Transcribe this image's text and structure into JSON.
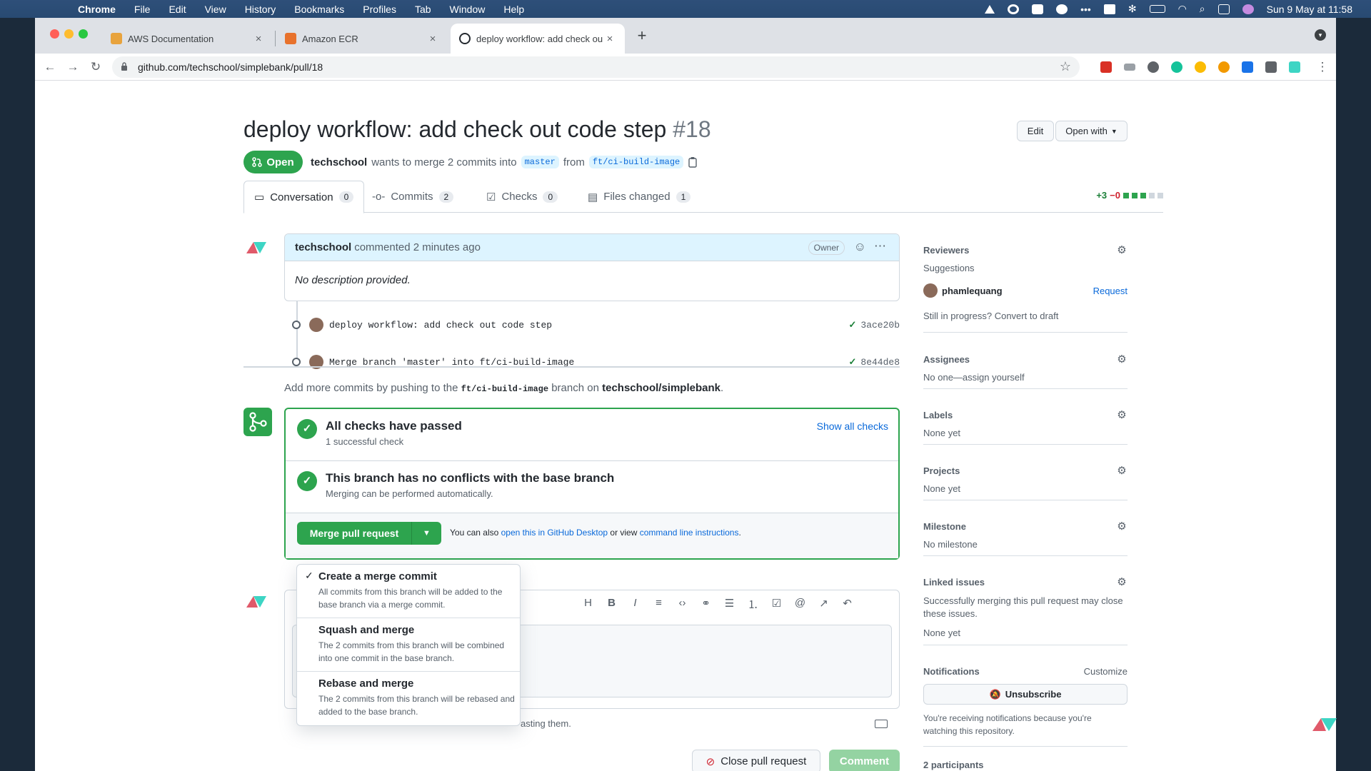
{
  "menubar": {
    "app": "Chrome",
    "items": [
      "File",
      "Edit",
      "View",
      "History",
      "Bookmarks",
      "Profiles",
      "Tab",
      "Window",
      "Help"
    ],
    "clock": "Sun 9 May at 11:58"
  },
  "browser": {
    "tabs": [
      {
        "label": "AWS Documentation",
        "favicon_color": "#e8a33d"
      },
      {
        "label": "Amazon ECR",
        "favicon_color": "#e8722c"
      },
      {
        "label": "deploy workflow: add check ou",
        "favicon_color": "#24292f"
      }
    ],
    "url": "github.com/techschool/simplebank/pull/18"
  },
  "pr": {
    "title": "deploy workflow: add check out code step",
    "number": "#18",
    "state": "Open",
    "author": "techschool",
    "meta_text": "wants to merge 2 commits into",
    "base_branch": "master",
    "from_text": "from",
    "head_branch": "ft/ci-build-image",
    "edit_label": "Edit",
    "open_with_label": "Open with"
  },
  "tabs": [
    {
      "label": "Conversation",
      "count": "0"
    },
    {
      "label": "Commits",
      "count": "2"
    },
    {
      "label": "Checks",
      "count": "0"
    },
    {
      "label": "Files changed",
      "count": "1"
    }
  ],
  "diffstat": {
    "additions": "+3",
    "deletions": "−0",
    "colors": [
      "#2da44e",
      "#2da44e",
      "#2da44e",
      "#d0d7de",
      "#d0d7de"
    ]
  },
  "comment": {
    "author": "techschool",
    "action": "commented 2 minutes ago",
    "role": "Owner",
    "body": "No description provided."
  },
  "commits": [
    {
      "message": "deploy workflow: add check out code step",
      "sha": "3ace20b"
    },
    {
      "message": "Merge branch 'master' into ft/ci-build-image",
      "sha": "8e44de8"
    }
  ],
  "push_hint": {
    "prefix": "Add more commits by pushing to the",
    "branch": "ft/ci-build-image",
    "middle": "branch on",
    "repo": "techschool/simplebank",
    "suffix": "."
  },
  "merge": {
    "checks_title": "All checks have passed",
    "checks_sub": "1 successful check",
    "show_all": "Show all checks",
    "conflict_title": "This branch has no conflicts with the base branch",
    "conflict_sub": "Merging can be performed automatically.",
    "button_label": "Merge pull request",
    "alt_prefix": "You can also",
    "alt_link1": "open this in GitHub Desktop",
    "alt_mid": "or view",
    "alt_link2": "command line instructions",
    "alt_suffix": "."
  },
  "merge_menu": [
    {
      "title": "Create a merge commit",
      "desc": "All commits from this branch will be added to the base branch via a merge commit.",
      "selected": true
    },
    {
      "title": "Squash and merge",
      "desc": "The 2 commits from this branch will be combined into one commit in the base branch.",
      "selected": false
    },
    {
      "title": "Rebase and merge",
      "desc": "The 2 commits from this branch will be rebased and added to the base branch.",
      "selected": false
    }
  ],
  "editor": {
    "attach_hint": "asting them.",
    "close_label": "Close pull request",
    "comment_label": "Comment"
  },
  "sidebar": {
    "reviewers": {
      "title": "Reviewers",
      "suggestions": "Suggestions",
      "name": "phamlequang",
      "request": "Request",
      "draft_hint": "Still in progress? Convert to draft"
    },
    "assignees": {
      "title": "Assignees",
      "value": "No one—assign yourself"
    },
    "labels": {
      "title": "Labels",
      "value": "None yet"
    },
    "projects": {
      "title": "Projects",
      "value": "None yet"
    },
    "milestone": {
      "title": "Milestone",
      "value": "No milestone"
    },
    "linked": {
      "title": "Linked issues",
      "desc": "Successfully merging this pull request may close these issues.",
      "value": "None yet"
    },
    "notifications": {
      "title": "Notifications",
      "customize": "Customize",
      "unsubscribe": "Unsubscribe",
      "desc": "You're receiving notifications because you're watching this repository."
    },
    "participants": {
      "title": "2 participants"
    }
  }
}
